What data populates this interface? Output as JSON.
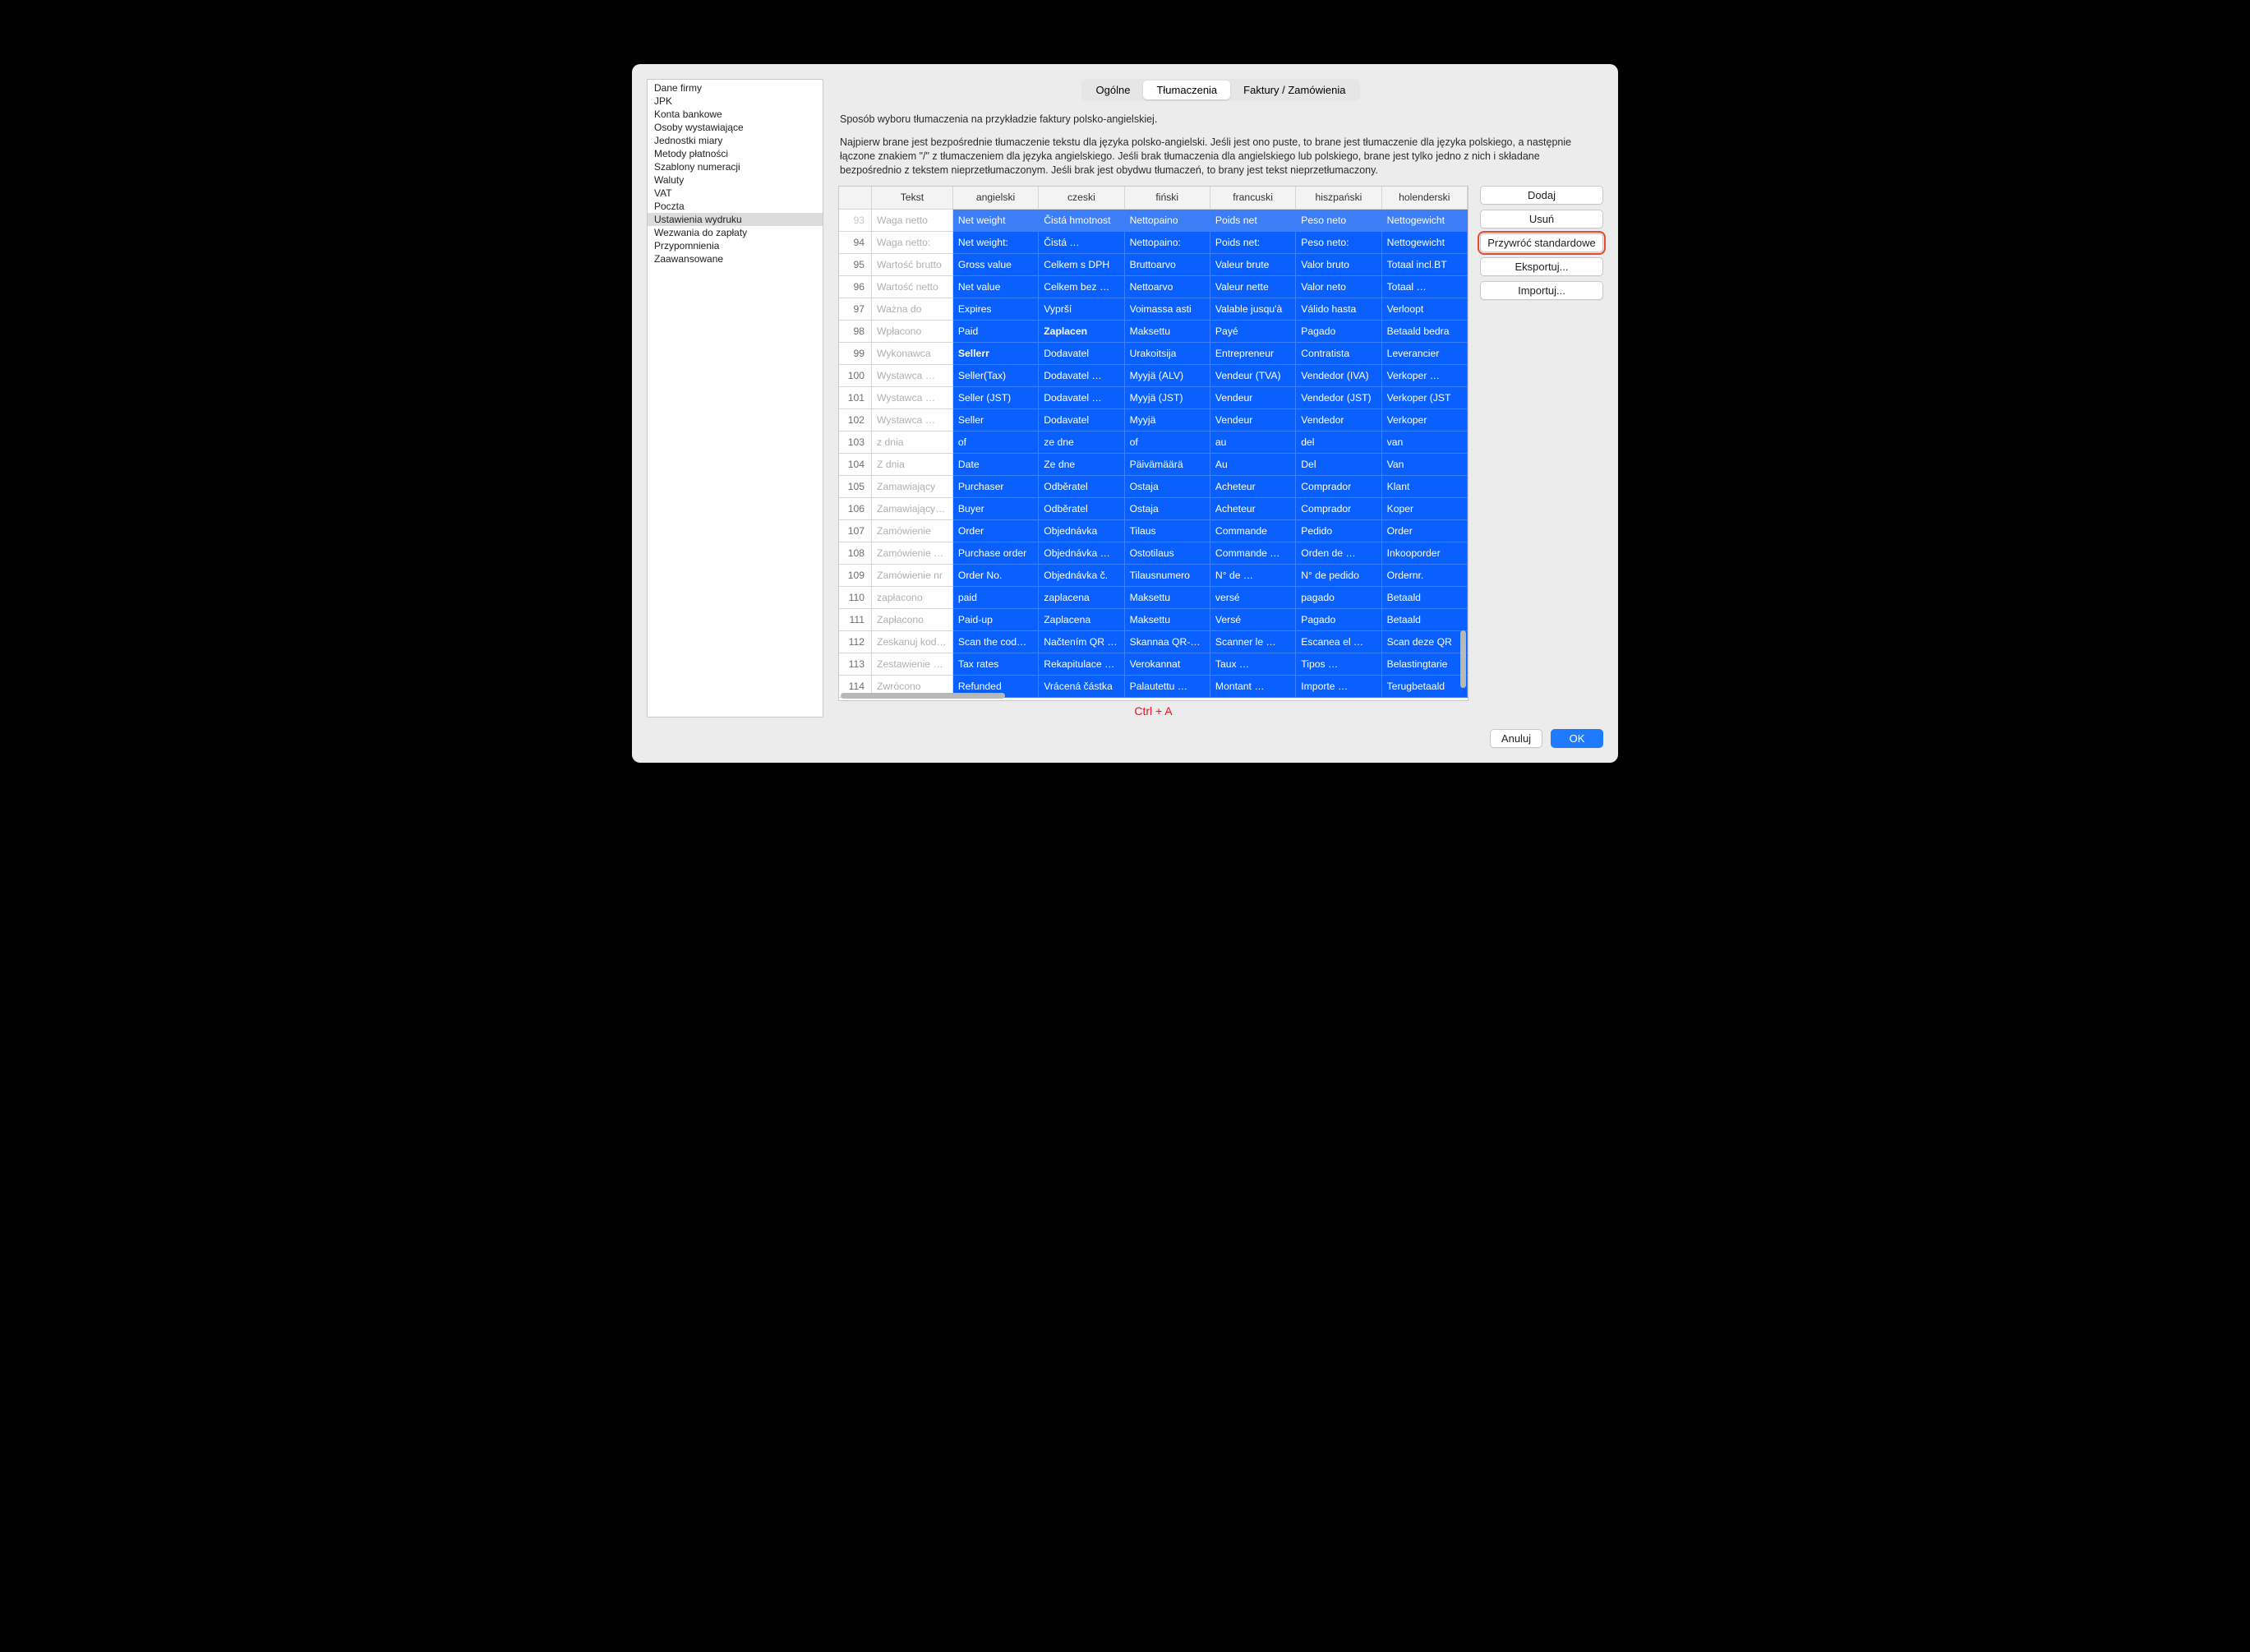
{
  "sidebar": {
    "items": [
      "Dane firmy",
      "JPK",
      "Konta bankowe",
      "Osoby wystawiające",
      "Jednostki miary",
      "Metody płatności",
      "Szablony numeracji",
      "Waluty",
      "VAT",
      "Poczta",
      "Ustawienia wydruku",
      "Wezwania do zapłaty",
      "Przypomnienia",
      "Zaawansowane"
    ],
    "selected_index": 10
  },
  "tabs": {
    "items": [
      "Ogólne",
      "Tłumaczenia",
      "Faktury / Zamówienia"
    ],
    "active_index": 1
  },
  "desc": {
    "line1": "Sposób wyboru tłumaczenia na przykładzie faktury polsko-angielskiej.",
    "line2": "Najpierw brane jest bezpośrednie tłumaczenie tekstu dla języka polsko-angielski. Jeśli jest ono puste, to brane jest tłumaczenie dla języka polskiego, a następnie łączone znakiem \"/\" z tłumaczeniem dla języka angielskiego. Jeśli brak tłumaczenia dla angielskiego lub polskiego, brane jest tylko jedno z nich i składane bezpośrednio z tekstem nieprzetłumaczonym. Jeśli brak jest obydwu tłumaczeń, to brany jest tekst nieprzetłumaczony."
  },
  "columns": [
    "",
    "Tekst",
    "angielski",
    "czeski",
    "fiński",
    "francuski",
    "hiszpański",
    "holenderski"
  ],
  "rows": [
    {
      "n": 93,
      "key": "Waga netto",
      "en": "Net weight",
      "cz": "Čistá hmotnost",
      "fi": "Nettopaino",
      "fr": "Poids net",
      "es": "Peso neto",
      "nl": "Nettogewicht"
    },
    {
      "n": 94,
      "key": "Waga netto:",
      "en": "Net weight:",
      "cz": "Čistá …",
      "fi": "Nettopaino:",
      "fr": "Poids net:",
      "es": "Peso neto:",
      "nl": "Nettogewicht"
    },
    {
      "n": 95,
      "key": "Wartość brutto",
      "en": "Gross value",
      "cz": "Celkem s DPH",
      "fi": "Bruttoarvo",
      "fr": "Valeur brute",
      "es": "Valor bruto",
      "nl": "Totaal incl.BT"
    },
    {
      "n": 96,
      "key": "Wartość netto",
      "en": "Net value",
      "cz": "Celkem bez …",
      "fi": "Nettoarvo",
      "fr": "Valeur nette",
      "es": "Valor neto",
      "nl": "Totaal …"
    },
    {
      "n": 97,
      "key": "Ważna do",
      "en": "Expires",
      "cz": "Vyprší",
      "fi": "Voimassa asti",
      "fr": "Valable jusqu'à",
      "es": "Válido hasta",
      "nl": "Verloopt"
    },
    {
      "n": 98,
      "key": "Wpłacono",
      "en": "Paid",
      "cz": "Zaplacen",
      "cz_bold": true,
      "fi": "Maksettu",
      "fr": "Payé",
      "es": "Pagado",
      "nl": "Betaald bedra"
    },
    {
      "n": 99,
      "key": "Wykonawca",
      "en": "Sellerr",
      "en_bold": true,
      "cz": "Dodavatel",
      "fi": "Urakoitsija",
      "fr": "Entrepreneur",
      "es": "Contratista",
      "nl": "Leverancier"
    },
    {
      "n": 100,
      "key": "Wystawca …",
      "en": "Seller(Tax)",
      "cz": "Dodavatel …",
      "fi": "Myyjä (ALV)",
      "fr": "Vendeur (TVA)",
      "es": "Vendedor (IVA)",
      "nl": "Verkoper …"
    },
    {
      "n": 101,
      "key": "Wystawca …",
      "en": "Seller (JST)",
      "cz": "Dodavatel …",
      "fi": "Myyjä (JST)",
      "fr": "Vendeur",
      "es": "Vendedor (JST)",
      "nl": "Verkoper (JST"
    },
    {
      "n": 102,
      "key": "Wystawca …",
      "en": "Seller",
      "cz": "Dodavatel",
      "fi": "Myyjä",
      "fr": "Vendeur",
      "es": "Vendedor",
      "nl": "Verkoper"
    },
    {
      "n": 103,
      "key": "z dnia",
      "en": "of",
      "cz": "ze dne",
      "fi": "of",
      "fr": "au",
      "es": "del",
      "nl": "van"
    },
    {
      "n": 104,
      "key": "Z dnia",
      "en": "Date",
      "cz": "Ze dne",
      "fi": "Päivämäärä",
      "fr": "Au",
      "es": "Del",
      "nl": "Van"
    },
    {
      "n": 105,
      "key": "Zamawiający",
      "en": "Purchaser",
      "cz": "Odběratel",
      "fi": "Ostaja",
      "fr": "Acheteur",
      "es": "Comprador",
      "nl": "Klant"
    },
    {
      "n": 106,
      "key": "Zamawiający …",
      "en": "Buyer",
      "cz": "Odběratel",
      "fi": "Ostaja",
      "fr": "Acheteur",
      "es": "Comprador",
      "nl": "Koper"
    },
    {
      "n": 107,
      "key": "Zamówienie",
      "en": "Order",
      "cz": "Objednávka",
      "fi": "Tilaus",
      "fr": "Commande",
      "es": "Pedido",
      "nl": "Order"
    },
    {
      "n": 108,
      "key": "Zamówienie d…",
      "en": "Purchase order",
      "cz": "Objednávka …",
      "fi": "Ostotilaus",
      "fr": "Commande …",
      "es": "Orden de …",
      "nl": "Inkooporder"
    },
    {
      "n": 109,
      "key": "Zamówienie nr",
      "en": "Order No.",
      "cz": "Objednávka č.",
      "fi": "Tilausnumero",
      "fr": "N° de …",
      "es": "N° de pedido",
      "nl": "Ordernr."
    },
    {
      "n": 110,
      "key": "zapłacono",
      "en": "paid",
      "cz": "zaplacena",
      "fi": "Maksettu",
      "fr": "versé",
      "es": "pagado",
      "nl": "Betaald"
    },
    {
      "n": 111,
      "key": "Zapłacono",
      "en": "Paid-up",
      "cz": "Zaplacena",
      "fi": "Maksettu",
      "fr": "Versé",
      "es": "Pagado",
      "nl": "Betaald"
    },
    {
      "n": 112,
      "key": "Zeskanuj kod …",
      "en": "Scan the cod…",
      "cz": "Načtením QR …",
      "fi": "Skannaa QR-…",
      "fr": "Scanner le …",
      "es": "Escanea el …",
      "nl": "Scan deze QR"
    },
    {
      "n": 113,
      "key": "Zestawienie …",
      "en": "Tax rates",
      "cz": "Rekapitulace …",
      "fi": "Verokannat",
      "fr": "Taux …",
      "es": "Tipos …",
      "nl": "Belastingtarie"
    },
    {
      "n": 114,
      "key": "Zwrócono",
      "en": "Refunded",
      "cz": "Vrácená částka",
      "fi": "Palautettu …",
      "fr": "Montant …",
      "es": "Importe …",
      "nl": "Terugbetaald"
    }
  ],
  "buttons": {
    "add": "Dodaj",
    "del": "Usuń",
    "reset": "Przywróć standardowe",
    "export": "Eksportuj...",
    "import": "Importuj..."
  },
  "hint": "Ctrl + A",
  "footer": {
    "cancel": "Anuluj",
    "ok": "OK"
  }
}
